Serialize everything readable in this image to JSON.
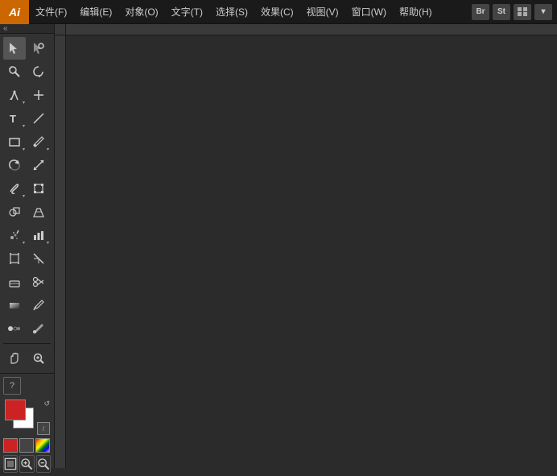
{
  "app": {
    "logo": "Ai",
    "logo_bg": "#cc6600"
  },
  "menubar": {
    "items": [
      {
        "label": "文件(F)",
        "id": "file"
      },
      {
        "label": "编辑(E)",
        "id": "edit"
      },
      {
        "label": "对象(O)",
        "id": "object"
      },
      {
        "label": "文字(T)",
        "id": "text"
      },
      {
        "label": "选择(S)",
        "id": "select"
      },
      {
        "label": "效果(C)",
        "id": "effect"
      },
      {
        "label": "视图(V)",
        "id": "view"
      },
      {
        "label": "窗口(W)",
        "id": "window"
      },
      {
        "label": "帮助(H)",
        "id": "help"
      }
    ],
    "right_buttons": [
      {
        "label": "Br",
        "id": "bridge"
      },
      {
        "label": "St",
        "id": "stock"
      }
    ]
  },
  "toolbar": {
    "collapse_label": "«",
    "tools": [
      [
        {
          "icon": "selection",
          "label": "选择工具",
          "has_arrow": false
        },
        {
          "icon": "direct-selection",
          "label": "直接选择工具",
          "has_arrow": false
        }
      ],
      [
        {
          "icon": "magic-wand",
          "label": "魔棒工具",
          "has_arrow": false
        },
        {
          "icon": "lasso",
          "label": "套索工具",
          "has_arrow": false
        }
      ],
      [
        {
          "icon": "pen",
          "label": "钢笔工具",
          "has_arrow": true
        },
        {
          "icon": "add-anchor",
          "label": "添加锚点工具",
          "has_arrow": false
        }
      ],
      [
        {
          "icon": "type",
          "label": "文字工具",
          "has_arrow": true
        },
        {
          "icon": "line",
          "label": "直线段工具",
          "has_arrow": false
        }
      ],
      [
        {
          "icon": "rect",
          "label": "矩形工具",
          "has_arrow": true
        },
        {
          "icon": "paintbrush",
          "label": "画笔工具",
          "has_arrow": true
        }
      ],
      [
        {
          "icon": "rotate",
          "label": "旋转工具",
          "has_arrow": false
        },
        {
          "icon": "scale",
          "label": "比例缩放工具",
          "has_arrow": false
        }
      ],
      [
        {
          "icon": "warp",
          "label": "变形工具",
          "has_arrow": true
        },
        {
          "icon": "free-transform",
          "label": "自由变换工具",
          "has_arrow": false
        }
      ],
      [
        {
          "icon": "shape-builder",
          "label": "形状生成器工具",
          "has_arrow": false
        },
        {
          "icon": "perspective",
          "label": "透视网格工具",
          "has_arrow": false
        }
      ],
      [
        {
          "icon": "symbol-sprayer",
          "label": "符号喷枪工具",
          "has_arrow": true
        },
        {
          "icon": "column-graph",
          "label": "柱形图工具",
          "has_arrow": true
        }
      ],
      [
        {
          "icon": "artboard",
          "label": "画板工具",
          "has_arrow": false
        },
        {
          "icon": "slice",
          "label": "切片工具",
          "has_arrow": false
        }
      ],
      [
        {
          "icon": "eraser",
          "label": "橡皮擦工具",
          "has_arrow": false
        },
        {
          "icon": "scissors",
          "label": "剪刀工具",
          "has_arrow": false
        }
      ],
      [
        {
          "icon": "gradient",
          "label": "渐变工具",
          "has_arrow": false
        },
        {
          "icon": "eyedropper",
          "label": "吸管工具",
          "has_arrow": false
        }
      ],
      [
        {
          "icon": "blend",
          "label": "混合工具",
          "has_arrow": false
        },
        {
          "icon": "live-paint",
          "label": "实时上色工具",
          "has_arrow": false
        }
      ],
      [
        {
          "icon": "zoom",
          "label": "缩放工具",
          "has_arrow": false
        },
        {
          "icon": "hand",
          "label": "抓手工具",
          "has_arrow": false
        }
      ]
    ],
    "bottom_tools": [
      {
        "icon": "question",
        "label": "工具提示"
      },
      {
        "icon": "color-mode",
        "label": "颜色模式"
      }
    ],
    "colors": {
      "foreground": "#cc2222",
      "background": "#ffffff",
      "reset_label": "↺",
      "none_label": "/"
    }
  },
  "canvas": {
    "background": "#2b2b2b"
  }
}
